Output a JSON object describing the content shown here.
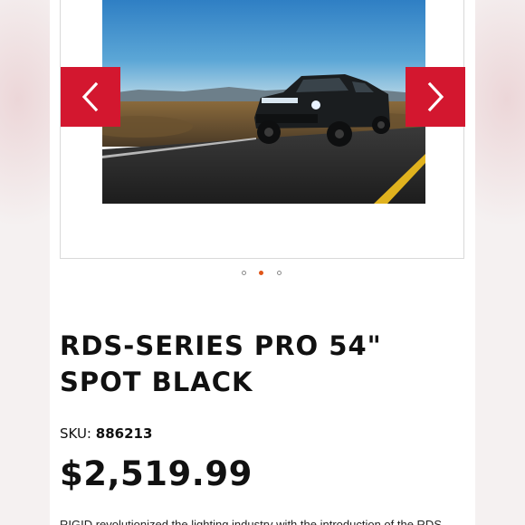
{
  "gallery": {
    "image_alt": "Black pickup truck with RDS-Series Pro light bar driving on desert highway",
    "prev_icon": "chevron-left-icon",
    "next_icon": "chevron-right-icon",
    "accent_color": "#d3172f",
    "dots": [
      {
        "active": false
      },
      {
        "active": true
      },
      {
        "active": false
      }
    ],
    "active_dot_color": "#e0561a",
    "active_index": 2,
    "image_count": 3
  },
  "product": {
    "title": "RDS-SERIES PRO 54\" SPOT BLACK",
    "sku_label": "SKU:",
    "sku_value": "886213",
    "price": "$2,519.99",
    "description": "RIGID revolutionized the lighting industry with the introduction of the RDS"
  }
}
